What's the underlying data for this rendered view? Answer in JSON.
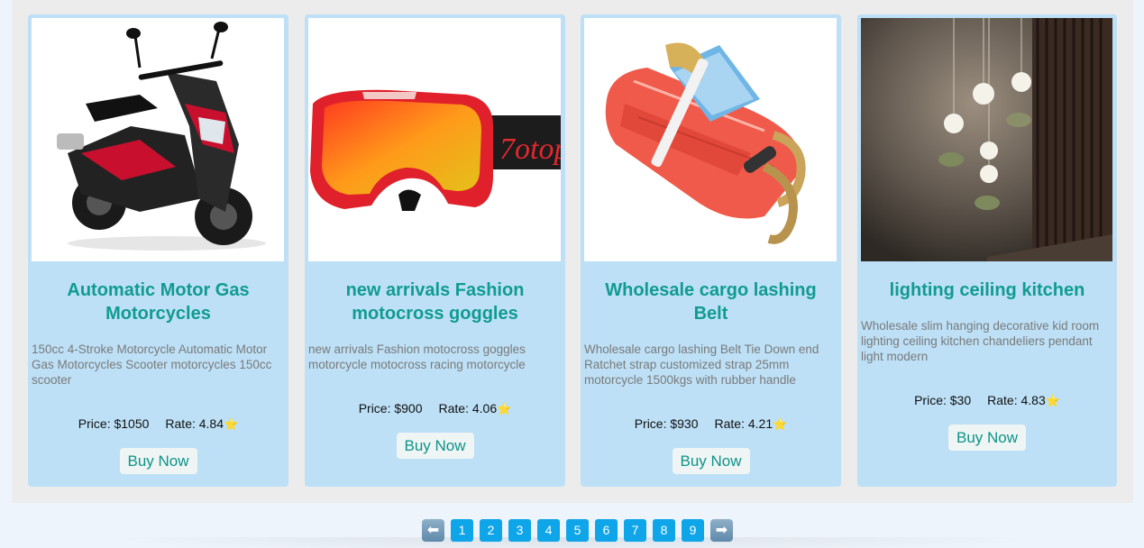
{
  "products": [
    {
      "title": "Automatic Motor Gas Motorcycles",
      "description": "150cc 4-Stroke Motorcycle Automatic Motor Gas Motorcycles Scooter motorcycles 150cc scooter",
      "price": "Price: $1050",
      "rate": "Rate: 4.84",
      "star": "⭐",
      "buy_label": "Buy Now",
      "image_icon": "scooter-image"
    },
    {
      "title": "new arrivals Fashion motocross goggles",
      "description": "new arrivals Fashion motocross goggles motorcycle motocross racing motorcycle",
      "price": "Price: $900",
      "rate": "Rate: 4.06",
      "star": "⭐",
      "buy_label": "Buy Now",
      "image_icon": "goggles-image",
      "image_text": "7otop"
    },
    {
      "title": "Wholesale cargo lashing Belt",
      "description": "Wholesale cargo lashing Belt Tie Down end Ratchet strap customized strap 25mm motorcycle 1500kgs with rubber handle",
      "price": "Price: $930",
      "rate": "Rate: 4.21",
      "star": "⭐",
      "buy_label": "Buy Now",
      "image_icon": "ratchet-strap-image"
    },
    {
      "title": "lighting ceiling kitchen",
      "description": "Wholesale slim hanging decorative kid room lighting ceiling kitchen chandeliers pendant light modern",
      "price": "Price: $30",
      "rate": "Rate: 4.83",
      "star": "⭐",
      "buy_label": "Buy Now",
      "image_icon": "pendant-lights-image"
    }
  ],
  "pagination": {
    "prev_icon": "⬅",
    "next_icon": "➡",
    "pages": [
      "1",
      "2",
      "3",
      "4",
      "5",
      "6",
      "7",
      "8",
      "9"
    ]
  },
  "colors": {
    "card_bg": "#bde0f6",
    "title": "#109b91",
    "button_text": "#0d9488",
    "page_button": "#0ea5e9"
  }
}
